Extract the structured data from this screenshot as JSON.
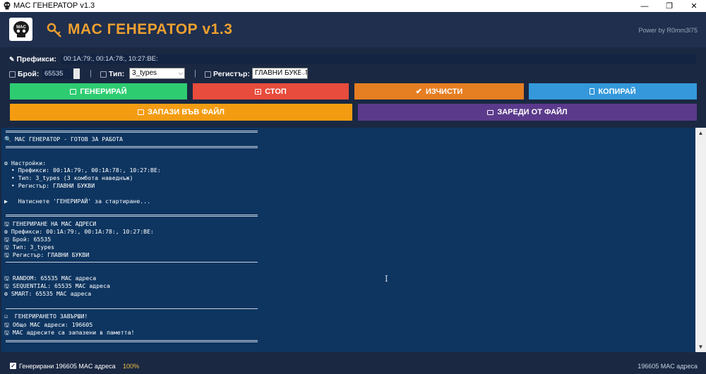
{
  "window": {
    "title": "MAC ГЕНЕРАТОР v1.3",
    "minimize": "—",
    "restore": "❐",
    "close": "✕"
  },
  "header": {
    "title": "MAC ГЕНЕРАТОР v1.3",
    "power": "Power by R0mm3l75",
    "logo_text": "MAC"
  },
  "controls": {
    "prefixes_label": "Префикси:",
    "prefixes_value": "00:1A:79:, 00:1A:78:, 10:27:BE:",
    "count_label": "Брой:",
    "count_value": "65535",
    "type_label": "Тип:",
    "type_value": "3_types",
    "case_label": "Регистър:",
    "case_value": "ГЛАВНИ БУКВИ",
    "sep": "|"
  },
  "buttons": {
    "generate": "ГЕНЕРИРАЙ",
    "stop": "СТОП",
    "clear": "ИЗЧИСТИ",
    "copy": "КОПИРАЙ",
    "save": "ЗАПАЗИ ВЪВ ФАЙЛ",
    "load": "ЗАРЕДИ ОТ ФАЙЛ"
  },
  "colors": {
    "generate": "#2ecc71",
    "stop": "#e74c3c",
    "clear": "#e67e22",
    "copy": "#3498db",
    "save": "#f39c12",
    "load": "#5b3a8c",
    "accent": "#f0a030"
  },
  "console": {
    "lines": [
      "🔍 MAC ГЕНЕРАТОР - ГОТОВ ЗА РАБОТА",
      "⚙ Настройки:",
      "  • Префикси: 00:1A:79:, 00:1A:78:, 10:27:BE:",
      "  • Тип: 3_types (3 комбота наведнъж)",
      "  • Регистър: ГЛАВНИ БУКВИ",
      "▶   Натиснете 'ГЕНЕРИРАЙ' за стартиране...",
      "🖫 ГЕНЕРИРАНЕ НА MAC АДРЕСИ",
      "⚙ Префикси: 00:1A:79:, 00:1A:78:, 10:27:BE:",
      "🖫 Брой: 65535",
      "🖫 Тип: 3_types",
      "🖫 Регистър: ГЛАВНИ БУКВИ",
      "🖫 RANDOM: 65535 MAC адреса",
      "🖫 SEQUENTIAL: 65535 MAC адреса",
      "⚙ SMART: 65535 MAC адреса",
      "☑  ГЕНЕРИРАНЕТО ЗАВЪРШИ!",
      "🖫 Общо MAC адреси: 196605",
      "🖫 MAC адресите са запазени в паметта!"
    ]
  },
  "status": {
    "text": "Генерирани 196605 MAC адреса",
    "percent": "100%",
    "count": "196605 MAC адреса",
    "progress": 1.0
  }
}
